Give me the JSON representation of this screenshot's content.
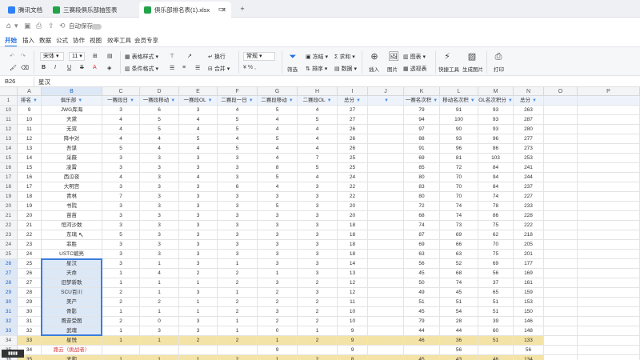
{
  "tabs": [
    {
      "label": "腾讯文档",
      "color": "#2f7ff7"
    },
    {
      "label": "三赛段俱乐部抽签表",
      "color": "#22a34a"
    },
    {
      "label": "俱乐部排名表(1).xlsx",
      "color": "#22a34a",
      "active": true
    }
  ],
  "quickbar": {
    "autosave_label": "自动保存"
  },
  "menu": [
    "开始",
    "插入",
    "数据",
    "公式",
    "协作",
    "视图",
    "效率工具",
    "会员专享"
  ],
  "ribbon": {
    "font": "宋体",
    "size": "11",
    "table_style": "表格样式",
    "cond_format": "条件格式",
    "wrap": "换行",
    "merge": "合并",
    "number_format": "常规",
    "filter": "筛选",
    "freeze": "冻结",
    "sort": "排序",
    "sum": "求和",
    "data": "数据",
    "insert": "插入",
    "image": "图片",
    "chart": "图表",
    "pivot": "透视表",
    "quick_tool": "快捷工具",
    "gen_image": "生成图片",
    "print": "打印"
  },
  "formula": {
    "cell": "B26",
    "value": "星汉"
  },
  "columns": [
    "A",
    "B",
    "C",
    "D",
    "E",
    "F",
    "G",
    "H",
    "I",
    "J",
    "K",
    "L",
    "M",
    "N",
    "O",
    "P"
  ],
  "header": [
    "排名",
    "俱乐部",
    "一赛段日",
    "一赛段移动",
    "一赛段OL",
    "二赛段一日",
    "二赛段移动",
    "二赛段OL",
    "总分",
    "",
    "一赛名次积",
    "移动名次积",
    "OL名次积分",
    "总分"
  ],
  "rows": [
    {
      "n": "10",
      "c": [
        "9",
        "JWG库海",
        "3",
        "6",
        "3",
        "4",
        "5",
        "4",
        "27",
        "",
        "79",
        "91",
        "93",
        "263"
      ]
    },
    {
      "n": "11",
      "c": [
        "10",
        "天黛",
        "4",
        "5",
        "4",
        "5",
        "4",
        "5",
        "27",
        "",
        "94",
        "100",
        "93",
        "287"
      ]
    },
    {
      "n": "12",
      "c": [
        "11",
        "无双",
        "4",
        "5",
        "4",
        "5",
        "4",
        "4",
        "26",
        "",
        "97",
        "90",
        "93",
        "280"
      ]
    },
    {
      "n": "13",
      "c": [
        "12",
        "降中对",
        "4",
        "4",
        "5",
        "4",
        "5",
        "4",
        "26",
        "",
        "88",
        "93",
        "96",
        "277"
      ]
    },
    {
      "n": "14",
      "c": [
        "13",
        "吾谋",
        "5",
        "4",
        "4",
        "5",
        "4",
        "4",
        "26",
        "",
        "91",
        "96",
        "86",
        "273"
      ]
    },
    {
      "n": "15",
      "c": [
        "14",
        "采薇",
        "3",
        "3",
        "3",
        "3",
        "4",
        "7",
        "25",
        "",
        "69",
        "81",
        "103",
        "253"
      ]
    },
    {
      "n": "16",
      "c": [
        "15",
        "凌霄",
        "3",
        "3",
        "3",
        "3",
        "8",
        "5",
        "25",
        "",
        "85",
        "72",
        "84",
        "241"
      ]
    },
    {
      "n": "17",
      "c": [
        "16",
        "西瓜夜",
        "4",
        "3",
        "4",
        "3",
        "5",
        "4",
        "24",
        "",
        "80",
        "70",
        "94",
        "244"
      ]
    },
    {
      "n": "18",
      "c": [
        "17",
        "大明宫",
        "3",
        "3",
        "3",
        "6",
        "4",
        "3",
        "22",
        "",
        "83",
        "70",
        "84",
        "237"
      ]
    },
    {
      "n": "19",
      "c": [
        "18",
        "青林",
        "7",
        "3",
        "3",
        "3",
        "3",
        "3",
        "22",
        "",
        "80",
        "70",
        "74",
        "227"
      ]
    },
    {
      "n": "20",
      "c": [
        "19",
        "书院",
        "3",
        "3",
        "3",
        "3",
        "5",
        "3",
        "20",
        "",
        "72",
        "74",
        "78",
        "233"
      ]
    },
    {
      "n": "21",
      "c": [
        "20",
        "苗苗",
        "3",
        "3",
        "3",
        "3",
        "3",
        "3",
        "20",
        "",
        "68",
        "74",
        "86",
        "228"
      ]
    },
    {
      "n": "22",
      "c": [
        "21",
        "恒河沙数",
        "3",
        "3",
        "3",
        "3",
        "3",
        "3",
        "18",
        "",
        "74",
        "73",
        "75",
        "222"
      ]
    },
    {
      "n": "23",
      "c": [
        "22",
        "东璃",
        "5",
        "3",
        "3",
        "3",
        "3",
        "3",
        "18",
        "",
        "87",
        "69",
        "62",
        "218"
      ]
    },
    {
      "n": "24",
      "c": [
        "23",
        "菲胜",
        "3",
        "3",
        "3",
        "3",
        "3",
        "3",
        "18",
        "",
        "69",
        "66",
        "70",
        "205"
      ]
    },
    {
      "n": "25",
      "c": [
        "24",
        "USTC毓亮",
        "3",
        "3",
        "3",
        "3",
        "3",
        "3",
        "18",
        "",
        "63",
        "63",
        "75",
        "201"
      ]
    },
    {
      "n": "26",
      "c": [
        "25",
        "星汉",
        "3",
        "1",
        "3",
        "1",
        "3",
        "3",
        "14",
        "",
        "56",
        "52",
        "69",
        "177"
      ]
    },
    {
      "n": "27",
      "c": [
        "26",
        "天命",
        "1",
        "4",
        "2",
        "2",
        "1",
        "3",
        "13",
        "",
        "45",
        "68",
        "56",
        "169"
      ]
    },
    {
      "n": "28",
      "c": [
        "27",
        "旧梦新歌",
        "1",
        "1",
        "1",
        "2",
        "3",
        "2",
        "12",
        "",
        "50",
        "74",
        "37",
        "161"
      ]
    },
    {
      "n": "29",
      "c": [
        "28",
        "SCU百川",
        "2",
        "1",
        "3",
        "1",
        "2",
        "3",
        "12",
        "",
        "49",
        "45",
        "65",
        "159"
      ]
    },
    {
      "n": "30",
      "c": [
        "29",
        "美产",
        "2",
        "2",
        "1",
        "2",
        "2",
        "2",
        "11",
        "",
        "51",
        "51",
        "51",
        "153"
      ]
    },
    {
      "n": "31",
      "c": [
        "30",
        "骨影",
        "1",
        "1",
        "1",
        "2",
        "3",
        "2",
        "10",
        "",
        "45",
        "54",
        "51",
        "150"
      ]
    },
    {
      "n": "32",
      "c": [
        "31",
        "鹰昔受图",
        "2",
        "0",
        "3",
        "1",
        "2",
        "2",
        "10",
        "",
        "79",
        "28",
        "39",
        "146"
      ]
    },
    {
      "n": "33",
      "c": [
        "32",
        "武魂",
        "1",
        "3",
        "3",
        "1",
        "0",
        "1",
        "9",
        "",
        "44",
        "44",
        "60",
        "148"
      ]
    },
    {
      "n": "34",
      "c": [
        "33",
        "星悦",
        "1",
        "1",
        "2",
        "2",
        "1",
        "2",
        "9",
        "",
        "46",
        "36",
        "51",
        "133"
      ],
      "hl": true
    },
    {
      "n": "35",
      "c": [
        "34",
        "路云（挑战者）",
        "",
        "",
        "",
        "",
        "9",
        "",
        "9",
        "",
        "",
        "56",
        "",
        "56"
      ],
      "red": true
    },
    {
      "n": "36",
      "c": [
        "35",
        "天和",
        "1",
        "1",
        "1",
        "2",
        "1",
        "2",
        "8",
        "",
        "45",
        "43",
        "46",
        "134"
      ],
      "hl": true
    }
  ],
  "colors": {
    "highlight_row": "#f4e3a6",
    "selection": "#dde8f7",
    "accent": "#1f6fe0",
    "red_text": "#d93a3a"
  }
}
